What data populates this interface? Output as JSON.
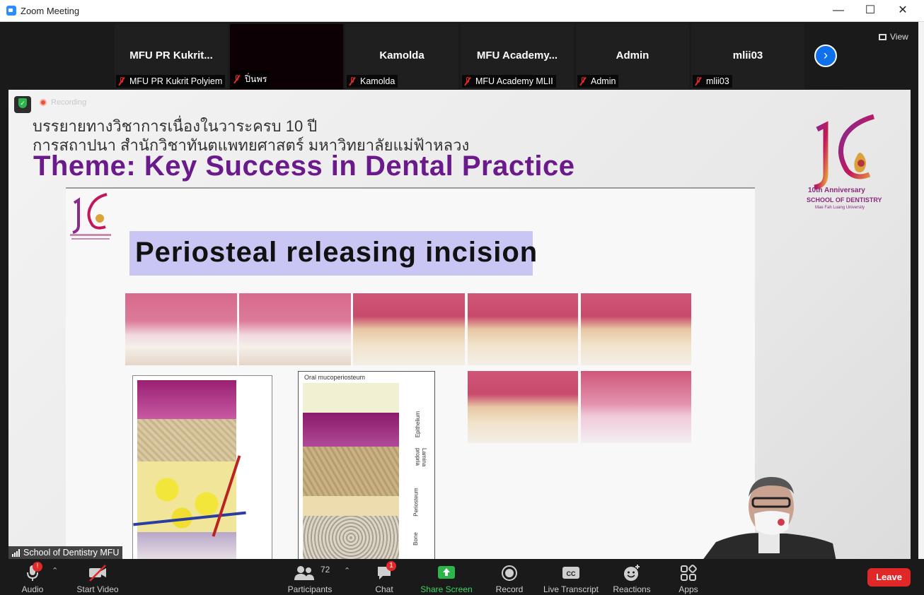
{
  "window": {
    "title": "Zoom Meeting",
    "minimize": "—",
    "maximize": "☐",
    "close": "✕"
  },
  "participants_strip": [
    {
      "display": "MFU PR Kukrit...",
      "label": "MFU PR Kukrit Polyiem"
    },
    {
      "display": "",
      "label": "ปิ่นพร"
    },
    {
      "display": "Kamolda",
      "label": "Kamolda"
    },
    {
      "display": "MFU Academy...",
      "label": "MFU Academy MLII"
    },
    {
      "display": "Admin",
      "label": "Admin"
    },
    {
      "display": "mlii03",
      "label": "mlii03"
    }
  ],
  "view_button": {
    "label": "View"
  },
  "share": {
    "recording_label": "Recording",
    "thai_line1": "บรรยายทางวิชาการเนื่องในวาระครบ 10 ปี",
    "thai_line2": "การสถาปนา สำนักวิชาทันตแพทยศาสตร์ มหาวิทยาลัยแม่ฟ้าหลวง",
    "theme": "Theme: Key Success in Dental Practice",
    "logo_text1": "10th Anniversary",
    "logo_text2": "SCHOOL OF DENTISTRY",
    "logo_text3": "Mae Fah Luang University",
    "slide_title": "Periosteal releasing incision",
    "diagram_header": "Oral mucoperiosteum",
    "diagram_labels": [
      "Epithelium",
      "Lamina propria",
      "Periosteum",
      "Bone"
    ],
    "presenter_name": "School of Dentistry MFU"
  },
  "toolbar": {
    "audio": "Audio",
    "audio_badge": "!",
    "start_video": "Start Video",
    "participants": "Participants",
    "participants_count": "72",
    "chat": "Chat",
    "chat_badge": "1",
    "share_screen": "Share Screen",
    "record": "Record",
    "live_transcript": "Live Transcript",
    "reactions": "Reactions",
    "apps": "Apps",
    "leave": "Leave"
  },
  "colors": {
    "accent": "#2d8cff",
    "share_green": "#2db44a",
    "leave_red": "#e02828",
    "theme_purple": "#6a1a8a",
    "slide_title_bg": "#c9c6f3"
  }
}
